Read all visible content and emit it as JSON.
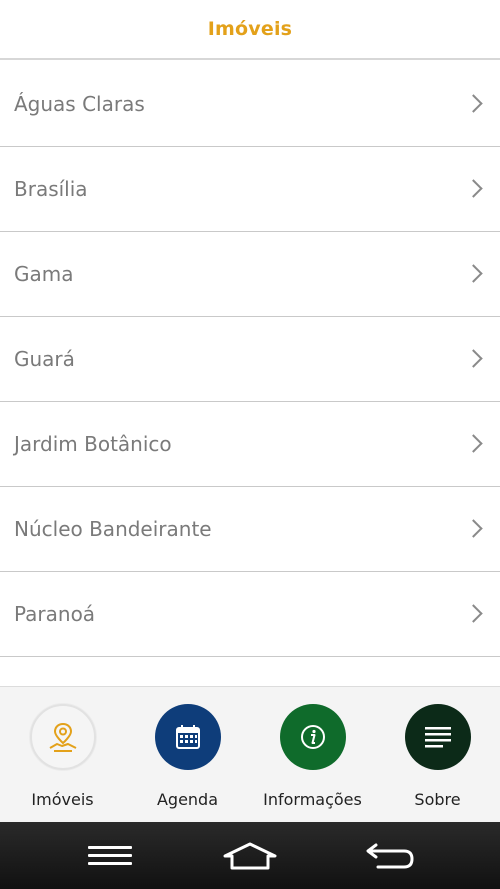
{
  "header": {
    "title": "Imóveis"
  },
  "list": {
    "items": [
      {
        "label": "Águas Claras"
      },
      {
        "label": "Brasília"
      },
      {
        "label": "Gama"
      },
      {
        "label": "Guará"
      },
      {
        "label": "Jardim Botânico"
      },
      {
        "label": "Núcleo Bandeirante"
      },
      {
        "label": "Paranoá"
      },
      {
        "label": ""
      }
    ]
  },
  "tabs": [
    {
      "label": "Imóveis",
      "icon": "location-pin-hand-icon",
      "color": "#f5f5f5",
      "icon_color": "#e3a11a"
    },
    {
      "label": "Agenda",
      "icon": "calendar-icon",
      "color": "#0e3d7a",
      "icon_color": "#ffffff"
    },
    {
      "label": "Informações",
      "icon": "info-icon",
      "color": "#0f6b2b",
      "icon_color": "#ffffff"
    },
    {
      "label": "Sobre",
      "icon": "menu-lines-icon",
      "color": "#0c2a18",
      "icon_color": "#ffffff"
    }
  ],
  "system_nav": {
    "buttons": [
      "menu",
      "home",
      "back"
    ]
  },
  "colors": {
    "accent": "#e3a11a",
    "list_text": "#7a7a7a",
    "divider": "#c9c9c9"
  }
}
